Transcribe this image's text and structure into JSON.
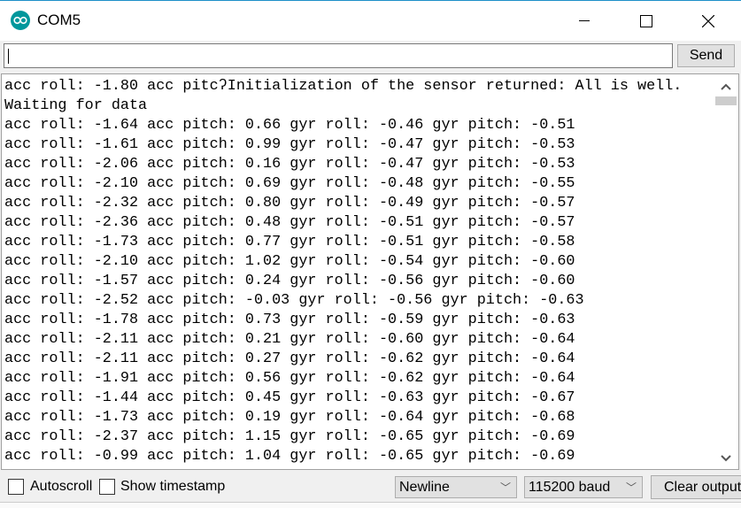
{
  "window": {
    "title": "COM5",
    "accent": "#00979c"
  },
  "send": {
    "input_value": "",
    "button_label": "Send"
  },
  "output_lines": [
    "acc roll: -1.80 acc pitcʔInitialization of the sensor returned: All is well.",
    "Waiting for data",
    "acc roll: -1.64 acc pitch: 0.66 gyr roll: -0.46 gyr pitch: -0.51",
    "acc roll: -1.61 acc pitch: 0.99 gyr roll: -0.47 gyr pitch: -0.53",
    "acc roll: -2.06 acc pitch: 0.16 gyr roll: -0.47 gyr pitch: -0.53",
    "acc roll: -2.10 acc pitch: 0.69 gyr roll: -0.48 gyr pitch: -0.55",
    "acc roll: -2.32 acc pitch: 0.80 gyr roll: -0.49 gyr pitch: -0.57",
    "acc roll: -2.36 acc pitch: 0.48 gyr roll: -0.51 gyr pitch: -0.57",
    "acc roll: -1.73 acc pitch: 0.77 gyr roll: -0.51 gyr pitch: -0.58",
    "acc roll: -2.10 acc pitch: 1.02 gyr roll: -0.54 gyr pitch: -0.60",
    "acc roll: -1.57 acc pitch: 0.24 gyr roll: -0.56 gyr pitch: -0.60",
    "acc roll: -2.52 acc pitch: -0.03 gyr roll: -0.56 gyr pitch: -0.63",
    "acc roll: -1.78 acc pitch: 0.73 gyr roll: -0.59 gyr pitch: -0.63",
    "acc roll: -2.11 acc pitch: 0.21 gyr roll: -0.60 gyr pitch: -0.64",
    "acc roll: -2.11 acc pitch: 0.27 gyr roll: -0.62 gyr pitch: -0.64",
    "acc roll: -1.91 acc pitch: 0.56 gyr roll: -0.62 gyr pitch: -0.64",
    "acc roll: -1.44 acc pitch: 0.45 gyr roll: -0.63 gyr pitch: -0.67",
    "acc roll: -1.73 acc pitch: 0.19 gyr roll: -0.64 gyr pitch: -0.68",
    "acc roll: -2.37 acc pitch: 1.15 gyr roll: -0.65 gyr pitch: -0.69",
    "acc roll: -0.99 acc pitch: 1.04 gyr roll: -0.65 gyr pitch: -0.69"
  ],
  "footer": {
    "autoscroll": {
      "label": "Autoscroll",
      "checked": false
    },
    "timestamp": {
      "label": "Show timestamp",
      "checked": false
    },
    "line_ending": "Newline",
    "baud": "115200 baud",
    "clear_label": "Clear output"
  },
  "icons": {
    "app": "arduino-icon",
    "minimize": "minimize-icon",
    "maximize": "maximize-icon",
    "close": "close-icon"
  }
}
